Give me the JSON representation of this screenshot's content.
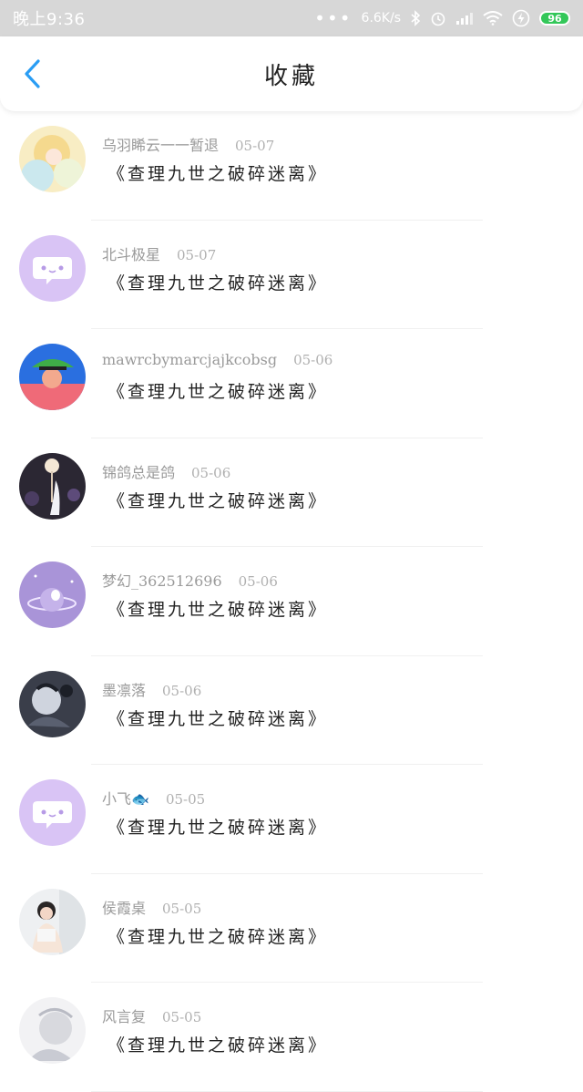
{
  "status_bar": {
    "time": "晚上9:36",
    "more": "•••",
    "net_speed": "6.6K/s",
    "battery": "96"
  },
  "header": {
    "title": "收藏"
  },
  "items": [
    {
      "user": "乌羽睎云一一暂退",
      "date": "05-07",
      "content": "《查理九世之破碎迷离》",
      "avatar": "photo-yellow"
    },
    {
      "user": "北斗极星",
      "date": "05-07",
      "content": "《查理九世之破碎迷离》",
      "avatar": "default-chat"
    },
    {
      "user": "mawrcbymarcjajkcobsg",
      "date": "05-06",
      "content": "《查理九世之破碎迷离》",
      "avatar": "photo-red"
    },
    {
      "user": "锦鸽总是鸽",
      "date": "05-06",
      "content": "《查理九世之破碎迷离》",
      "avatar": "photo-night"
    },
    {
      "user": "梦幻_362512696",
      "date": "05-06",
      "content": "《查理九世之破碎迷离》",
      "avatar": "photo-lavender"
    },
    {
      "user": "墨凛落",
      "date": "05-06",
      "content": "《查理九世之破碎迷离》",
      "avatar": "photo-dark"
    },
    {
      "user": "小飞🐟",
      "date": "05-05",
      "content": "《查理九世之破碎迷离》",
      "avatar": "default-chat"
    },
    {
      "user": "侯霞桌",
      "date": "05-05",
      "content": "《查理九世之破碎迷离》",
      "avatar": "photo-girl"
    },
    {
      "user": "风言复",
      "date": "05-05",
      "content": "《查理九世之破碎迷离》",
      "avatar": "photo-white"
    }
  ],
  "colors": {
    "status_bar_bg": "#d7d7d7",
    "accent_blue": "#2a9df4",
    "default_avatar": "#d9c4f5"
  }
}
